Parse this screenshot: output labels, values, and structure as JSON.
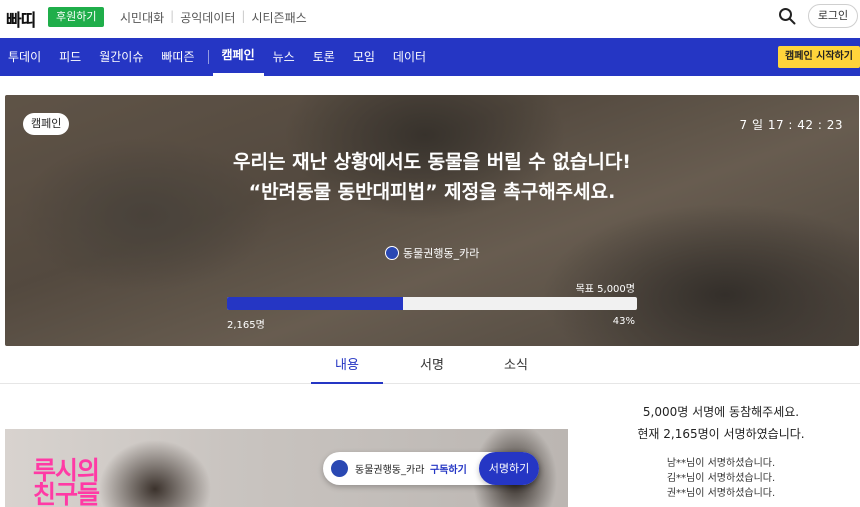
{
  "header": {
    "logo": "빠띠",
    "donate_label": "후원하기",
    "links": [
      "시민대화",
      "공익데이터",
      "시티즌패스"
    ],
    "login_label": "로그인"
  },
  "nav": {
    "items": [
      "투데이",
      "피드",
      "월간이슈",
      "빠띠즌"
    ],
    "items_right": [
      "캠페인",
      "뉴스",
      "토론",
      "모임",
      "데이터"
    ],
    "active": "캠페인",
    "start_label": "캠페인 시작하기"
  },
  "hero": {
    "badge": "캠페인",
    "timer": "7 일 17 : 42 : 23",
    "title": "우리는 재난 상황에서도 동물을 버릴 수 없습니다! “반려동물 동반대피법” 제정을 촉구해주세요.",
    "org": "동물권행동_카라",
    "goal": "목표 5,000명",
    "count": "2,165명",
    "percent": "43%",
    "progress": 0.43
  },
  "tabs": [
    "내용",
    "서명",
    "소식"
  ],
  "content": {
    "image_text": "루시의\n친구들",
    "org": "동물권행동_카라",
    "subscribe_label": "구독하기",
    "sign_label": "서명하기"
  },
  "side": {
    "line1": "5,000명 서명에 동참해주세요.",
    "line2": "현재 2,165명이 서명하였습니다.",
    "signers": [
      "남**님이 서명하셨습니다.",
      "김**님이 서명하셨습니다.",
      "권**님이 서명하셨습니다."
    ]
  },
  "colors": {
    "primary": "#2536c4",
    "donate": "#1fae4a",
    "cta": "#ffd43b",
    "pink": "#ff3aa5"
  }
}
